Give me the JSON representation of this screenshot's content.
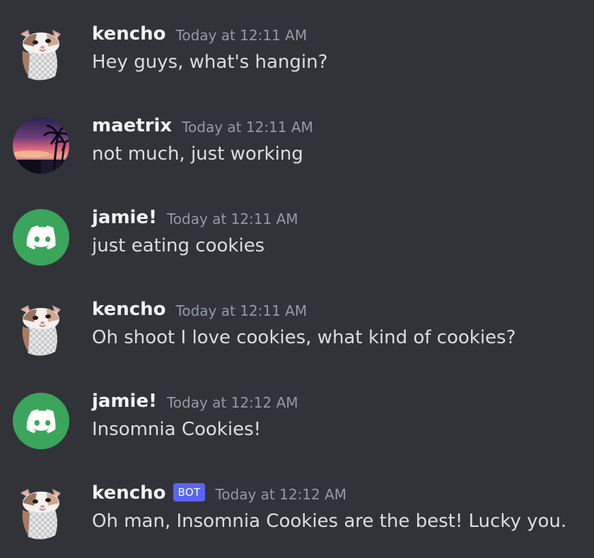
{
  "colors": {
    "background": "#313338",
    "username": "#f2f3f5",
    "message_text": "#dbdee1",
    "timestamp": "#949ba4",
    "bot_tag": "#5865f2",
    "discord_default_avatar": "#3ba55c"
  },
  "messages": [
    {
      "avatar": "hamster-avatar",
      "username": "kencho",
      "timestamp": "Today at 12:11 AM",
      "content": "Hey guys, what's hangin?"
    },
    {
      "avatar": "palm-sunset-avatar",
      "username": "maetrix",
      "timestamp": "Today at 12:11 AM",
      "content": "not much, just working"
    },
    {
      "avatar": "discord-logo-avatar",
      "username": "jamie!",
      "timestamp": "Today at 12:11 AM",
      "content": "just eating cookies"
    },
    {
      "avatar": "hamster-avatar",
      "username": "kencho",
      "timestamp": "Today at 12:11 AM",
      "content": "Oh shoot I love cookies, what kind of cookies?"
    },
    {
      "avatar": "discord-logo-avatar",
      "username": "jamie!",
      "timestamp": "Today at 12:12 AM",
      "content": "Insomnia Cookies!"
    },
    {
      "avatar": "hamster-avatar",
      "username": "kencho",
      "bot_tag": "BOT",
      "timestamp": "Today at 12:12 AM",
      "content": "Oh man, Insomnia Cookies are the best! Lucky you."
    }
  ]
}
